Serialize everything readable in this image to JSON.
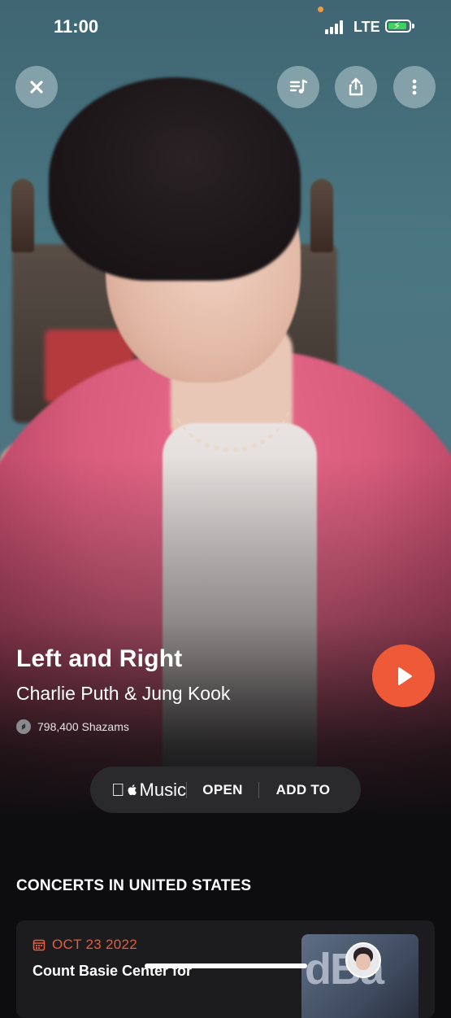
{
  "status_bar": {
    "time": "11:00",
    "network": "LTE",
    "battery_icon": "battery-charging-icon",
    "battery_color": "#3ed35d"
  },
  "toolbar": {
    "close_icon": "close-icon",
    "queue_icon": "music-queue-icon",
    "share_icon": "share-icon",
    "more_icon": "more-vertical-icon"
  },
  "song": {
    "title": "Left and Right",
    "artist": "Charlie Puth & Jung Kook",
    "shazam_count": "798,400 Shazams"
  },
  "play_button": {
    "icon": "play-icon",
    "color": "#ee5a37"
  },
  "apple_music": {
    "brand": "Music",
    "open_label": "OPEN",
    "add_label": "ADD TO"
  },
  "concerts": {
    "heading": "CONCERTS IN UNITED STATES",
    "items": [
      {
        "date": "OCT 23 2022",
        "venue": "Count Basie Center for",
        "thumb_text": "dBa"
      }
    ]
  },
  "colors": {
    "accent": "#ee5a37",
    "background": "#0d0d0f",
    "pill": "#2a2a2c",
    "card": "#1c1c1e"
  }
}
